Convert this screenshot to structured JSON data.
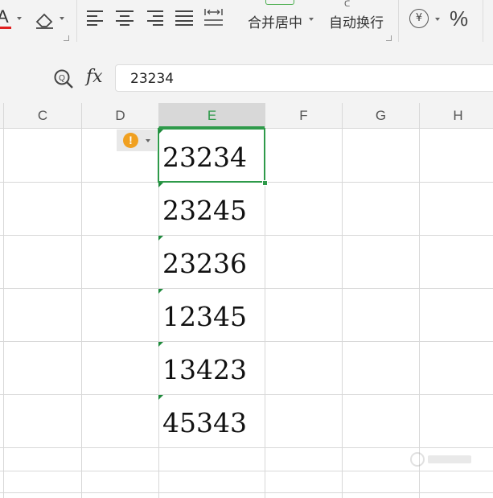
{
  "ribbon": {
    "merge_center_label": "合并居中",
    "wrap_text_label": "自动换行",
    "currency_symbol": "¥",
    "percent_symbol": "%",
    "font_color_glyph": "A"
  },
  "formula_bar": {
    "fx_label": "fx",
    "value": "23234"
  },
  "columns": [
    "C",
    "D",
    "E",
    "F",
    "G",
    "H"
  ],
  "active_column": "E",
  "cells": [
    "23234",
    "23245",
    "23236",
    "12345",
    "13423",
    "45343"
  ],
  "warning_glyph": "!",
  "colors": {
    "accent_green": "#2e9a4a",
    "warning_orange": "#f0a020",
    "font_color_red": "#e02020"
  }
}
